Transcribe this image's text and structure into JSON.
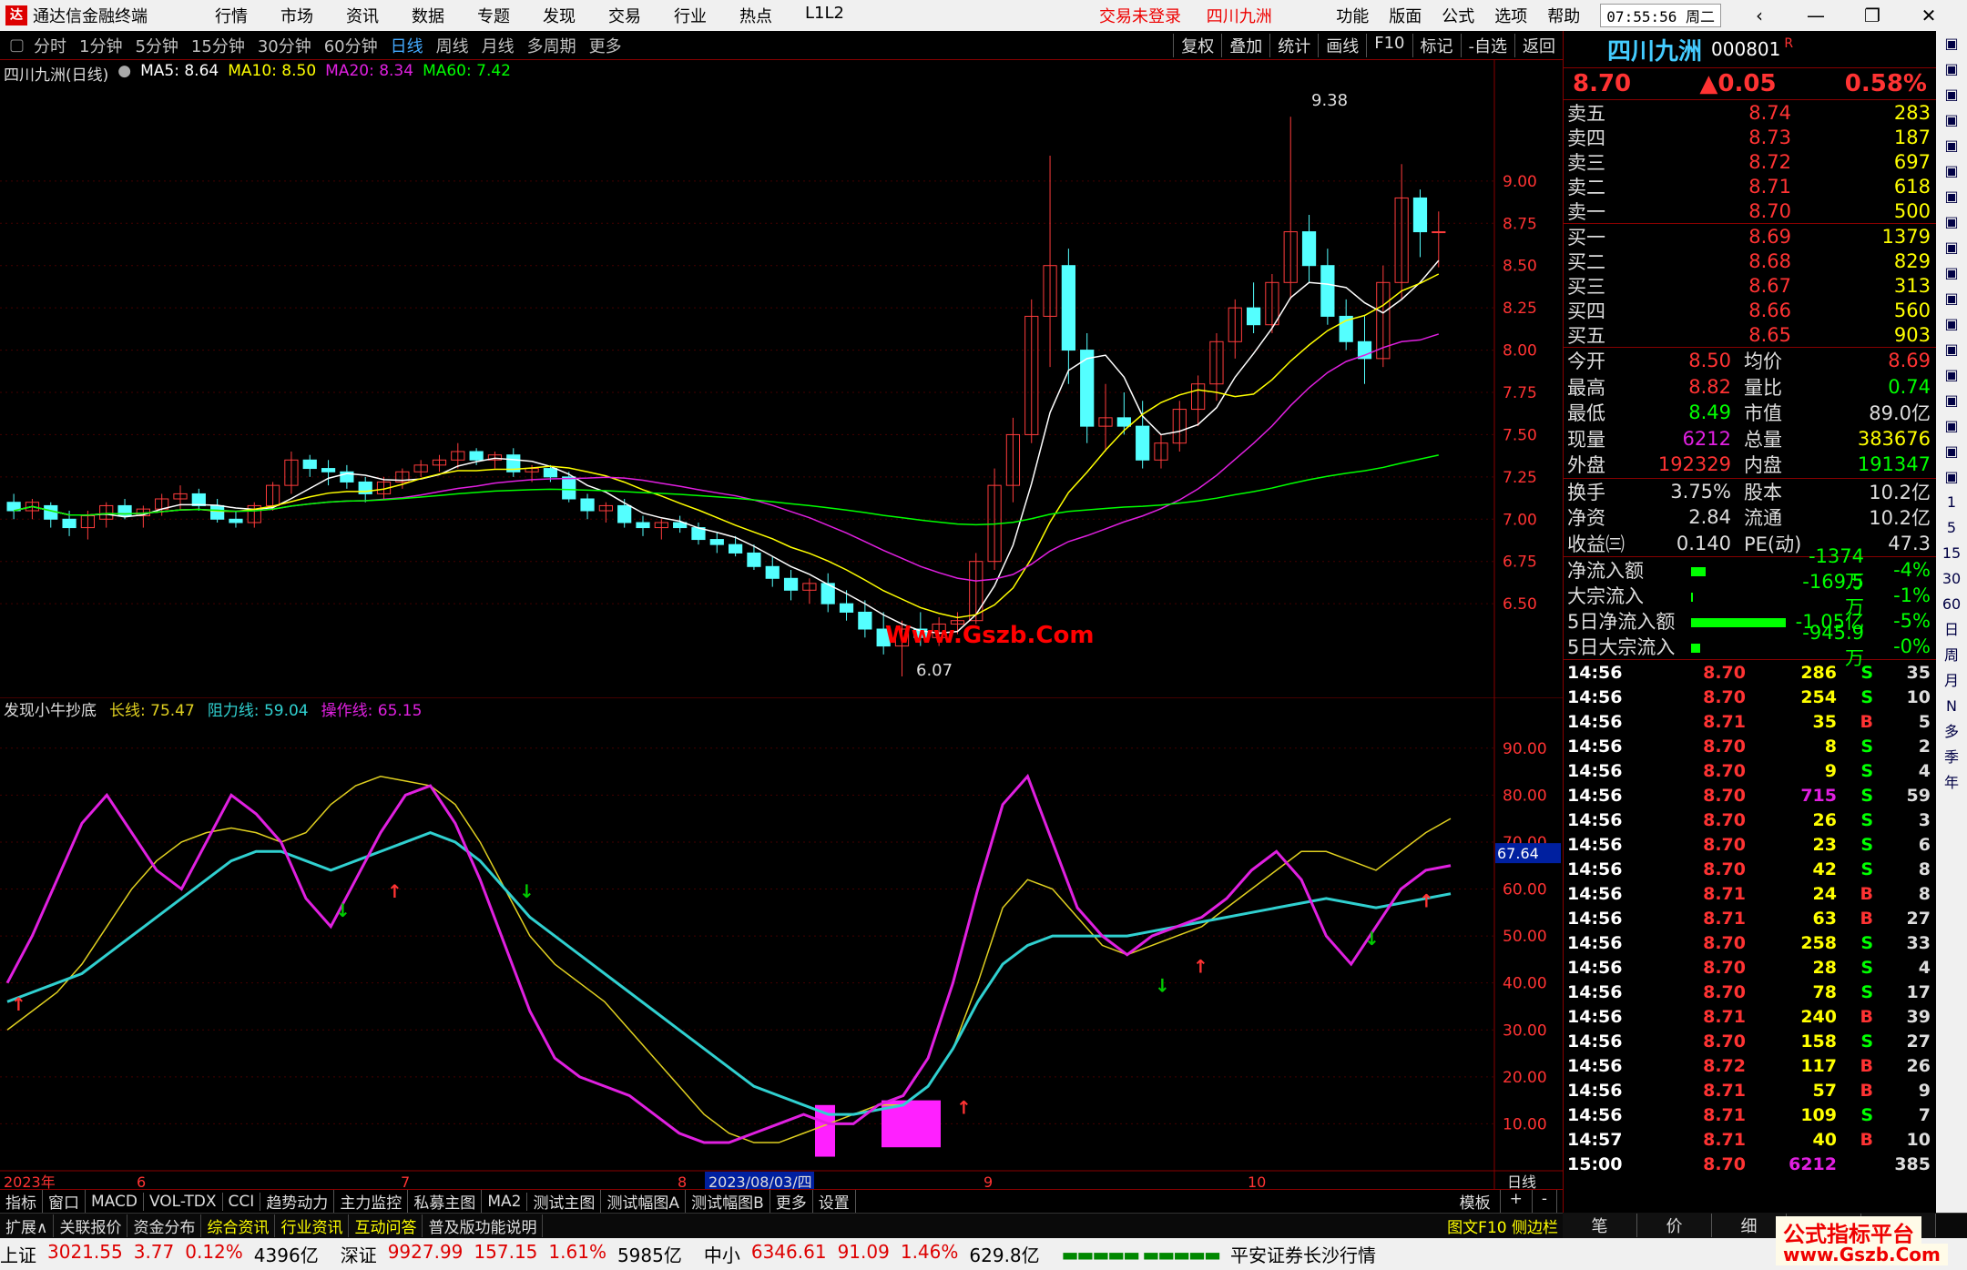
{
  "titlebar": {
    "app_title": "通达信金融终端",
    "menu": [
      "行情",
      "市场",
      "资讯",
      "数据",
      "专题",
      "发现",
      "交易",
      "行业",
      "热点",
      "L1L2"
    ],
    "login_status": "交易未登录",
    "stock_name": "四川九洲",
    "right_menu": [
      "功能",
      "版面",
      "公式",
      "选项",
      "帮助"
    ],
    "clock": "07:55:56 周二"
  },
  "periodbar": {
    "periods": [
      "分时",
      "1分钟",
      "5分钟",
      "15分钟",
      "30分钟",
      "60分钟",
      "日线",
      "周线",
      "月线",
      "多周期",
      "更多"
    ],
    "active": "日线",
    "tools": [
      "复权",
      "叠加",
      "统计",
      "画线",
      "F10",
      "标记",
      "-自选",
      "返回"
    ]
  },
  "main_legend": {
    "name": "四川九洲(日线)",
    "ma5": "MA5: 8.64",
    "ma10": "MA10: 8.50",
    "ma20": "MA20: 8.34",
    "ma60": "MA60: 7.42"
  },
  "ind_legend": {
    "name": "发现小牛抄底",
    "l1": "长线: 75.47",
    "l2": "阻力线: 59.04",
    "l3": "操作线: 65.15"
  },
  "chart_data": [
    {
      "type": "candlestick",
      "title": "四川九洲(日线)",
      "ylim": [
        6.0,
        9.5
      ],
      "yticks": [
        "9.00",
        "8.75",
        "8.50",
        "8.25",
        "8.00",
        "7.75",
        "7.50",
        "7.25",
        "7.00",
        "6.75",
        "6.50"
      ],
      "annotations": [
        "9.38",
        "6.07",
        "Www.Gszb.Com"
      ],
      "ohlc": [
        [
          7.1,
          7.15,
          7.0,
          7.05
        ],
        [
          7.05,
          7.12,
          7.0,
          7.1
        ],
        [
          7.08,
          7.1,
          6.95,
          7.0
        ],
        [
          7.0,
          7.05,
          6.9,
          6.95
        ],
        [
          6.95,
          7.05,
          6.88,
          7.02
        ],
        [
          7.0,
          7.1,
          6.95,
          7.08
        ],
        [
          7.08,
          7.12,
          7.0,
          7.02
        ],
        [
          7.02,
          7.08,
          6.95,
          7.06
        ],
        [
          7.06,
          7.15,
          7.02,
          7.12
        ],
        [
          7.12,
          7.2,
          7.05,
          7.15
        ],
        [
          7.15,
          7.18,
          7.05,
          7.08
        ],
        [
          7.08,
          7.12,
          6.98,
          7.0
        ],
        [
          7.0,
          7.05,
          6.95,
          6.98
        ],
        [
          6.98,
          7.1,
          6.95,
          7.08
        ],
        [
          7.08,
          7.22,
          7.05,
          7.2
        ],
        [
          7.2,
          7.4,
          7.15,
          7.35
        ],
        [
          7.35,
          7.38,
          7.25,
          7.3
        ],
        [
          7.3,
          7.35,
          7.2,
          7.28
        ],
        [
          7.28,
          7.32,
          7.18,
          7.22
        ],
        [
          7.22,
          7.25,
          7.1,
          7.15
        ],
        [
          7.15,
          7.25,
          7.12,
          7.22
        ],
        [
          7.22,
          7.3,
          7.18,
          7.28
        ],
        [
          7.28,
          7.35,
          7.25,
          7.32
        ],
        [
          7.32,
          7.38,
          7.28,
          7.35
        ],
        [
          7.35,
          7.45,
          7.3,
          7.4
        ],
        [
          7.4,
          7.42,
          7.32,
          7.35
        ],
        [
          7.35,
          7.4,
          7.3,
          7.38
        ],
        [
          7.38,
          7.42,
          7.25,
          7.28
        ],
        [
          7.28,
          7.32,
          7.22,
          7.3
        ],
        [
          7.3,
          7.32,
          7.22,
          7.25
        ],
        [
          7.25,
          7.28,
          7.1,
          7.12
        ],
        [
          7.12,
          7.15,
          7.0,
          7.05
        ],
        [
          7.05,
          7.1,
          6.98,
          7.08
        ],
        [
          7.08,
          7.12,
          6.95,
          6.98
        ],
        [
          6.98,
          7.02,
          6.9,
          6.95
        ],
        [
          6.95,
          7.0,
          6.88,
          6.98
        ],
        [
          6.98,
          7.02,
          6.92,
          6.95
        ],
        [
          6.95,
          6.98,
          6.85,
          6.88
        ],
        [
          6.88,
          6.92,
          6.8,
          6.85
        ],
        [
          6.85,
          6.9,
          6.78,
          6.8
        ],
        [
          6.8,
          6.85,
          6.7,
          6.72
        ],
        [
          6.72,
          6.78,
          6.6,
          6.65
        ],
        [
          6.65,
          6.7,
          6.52,
          6.58
        ],
        [
          6.58,
          6.65,
          6.5,
          6.62
        ],
        [
          6.62,
          6.68,
          6.45,
          6.5
        ],
        [
          6.5,
          6.58,
          6.4,
          6.45
        ],
        [
          6.45,
          6.52,
          6.3,
          6.35
        ],
        [
          6.35,
          6.45,
          6.2,
          6.25
        ],
        [
          6.25,
          6.4,
          6.07,
          6.35
        ],
        [
          6.35,
          6.45,
          6.25,
          6.3
        ],
        [
          6.3,
          6.42,
          6.25,
          6.38
        ],
        [
          6.38,
          6.45,
          6.32,
          6.4
        ],
        [
          6.4,
          6.8,
          6.38,
          6.75
        ],
        [
          6.75,
          7.3,
          6.7,
          7.2
        ],
        [
          7.2,
          7.6,
          7.1,
          7.5
        ],
        [
          7.5,
          8.3,
          7.45,
          8.2
        ],
        [
          8.2,
          9.15,
          7.9,
          8.5
        ],
        [
          8.5,
          8.6,
          7.8,
          8.0
        ],
        [
          8.0,
          8.1,
          7.45,
          7.55
        ],
        [
          7.55,
          7.8,
          7.4,
          7.6
        ],
        [
          7.6,
          7.75,
          7.5,
          7.55
        ],
        [
          7.55,
          7.7,
          7.3,
          7.35
        ],
        [
          7.35,
          7.5,
          7.3,
          7.45
        ],
        [
          7.45,
          7.7,
          7.4,
          7.65
        ],
        [
          7.65,
          7.85,
          7.55,
          7.8
        ],
        [
          7.8,
          8.1,
          7.7,
          8.05
        ],
        [
          8.05,
          8.3,
          7.95,
          8.25
        ],
        [
          8.25,
          8.4,
          8.1,
          8.15
        ],
        [
          8.15,
          8.45,
          8.1,
          8.4
        ],
        [
          8.4,
          9.38,
          8.3,
          8.7
        ],
        [
          8.7,
          8.8,
          8.4,
          8.5
        ],
        [
          8.5,
          8.6,
          8.15,
          8.2
        ],
        [
          8.2,
          8.3,
          8.0,
          8.05
        ],
        [
          8.05,
          8.2,
          7.8,
          7.95
        ],
        [
          7.95,
          8.5,
          7.9,
          8.4
        ],
        [
          8.4,
          9.1,
          8.3,
          8.9
        ],
        [
          8.9,
          8.95,
          8.55,
          8.7
        ],
        [
          8.7,
          8.82,
          8.49,
          8.7
        ]
      ]
    },
    {
      "type": "line",
      "title": "发现小牛抄底",
      "ylim": [
        0,
        95
      ],
      "yticks": [
        "90.00",
        "80.00",
        "70.00",
        "60.00",
        "50.00",
        "40.00",
        "30.00",
        "20.00",
        "10.00"
      ],
      "current_label": "67.64",
      "xlabels": [
        "2023年",
        "6",
        "7",
        "8",
        "2023/08/03/四",
        "9",
        "10",
        "日线"
      ],
      "series": [
        {
          "name": "长线",
          "color": "#e0d020",
          "values": [
            30,
            34,
            38,
            44,
            52,
            60,
            66,
            70,
            72,
            73,
            72,
            70,
            72,
            78,
            82,
            84,
            83,
            82,
            78,
            70,
            60,
            50,
            44,
            40,
            36,
            30,
            24,
            18,
            12,
            8,
            6,
            6,
            8,
            10,
            12,
            14,
            14,
            18,
            26,
            40,
            56,
            62,
            60,
            54,
            48,
            46,
            48,
            50,
            52,
            56,
            60,
            64,
            68,
            68,
            66,
            64,
            68,
            72,
            75
          ]
        },
        {
          "name": "阻力线",
          "color": "#30d0d0",
          "values": [
            36,
            38,
            40,
            42,
            46,
            50,
            54,
            58,
            62,
            66,
            68,
            68,
            66,
            64,
            66,
            68,
            70,
            72,
            70,
            66,
            60,
            54,
            50,
            46,
            42,
            38,
            34,
            30,
            26,
            22,
            18,
            16,
            14,
            12,
            12,
            13,
            14,
            18,
            26,
            36,
            44,
            48,
            50,
            50,
            50,
            50,
            51,
            52,
            53,
            54,
            55,
            56,
            57,
            58,
            57,
            56,
            57,
            58,
            59
          ]
        },
        {
          "name": "操作线",
          "color": "#e020e0",
          "values": [
            40,
            50,
            62,
            74,
            80,
            72,
            64,
            60,
            70,
            80,
            76,
            70,
            58,
            52,
            62,
            72,
            80,
            82,
            74,
            62,
            48,
            34,
            24,
            20,
            18,
            16,
            12,
            8,
            6,
            6,
            8,
            10,
            12,
            10,
            10,
            14,
            16,
            24,
            40,
            60,
            78,
            84,
            70,
            56,
            50,
            46,
            50,
            52,
            54,
            58,
            64,
            68,
            62,
            50,
            44,
            52,
            60,
            64,
            65
          ]
        }
      ]
    }
  ],
  "ind_tabs": [
    "指标",
    "窗口",
    "MACD",
    "VOL-TDX",
    "CCI",
    "趋势动力",
    "主力监控",
    "私募主图",
    "MA2",
    "测试主图",
    "测试幅图A",
    "测试幅图B",
    "更多",
    "设置"
  ],
  "ind_tabs_right": [
    "模板",
    "+",
    "-"
  ],
  "bottom_tabs": [
    "扩展∧",
    "关联报价",
    "资金分布",
    "综合资讯",
    "行业资讯",
    "互动问答",
    "普及版功能说明"
  ],
  "bottom_tabs_sel": [
    "综合资讯",
    "行业资讯",
    "互动问答"
  ],
  "bottom_right": "图文F10 侧边栏《",
  "right_bottom_tabs": [
    "笔",
    "价",
    "细",
    "势",
    "联"
  ],
  "statusbar": {
    "items": [
      {
        "name": "上证",
        "val": "3021.55",
        "chg": "3.77",
        "pct": "0.12%",
        "amt": "4396亿"
      },
      {
        "name": "深证",
        "val": "9927.99",
        "chg": "157.15",
        "pct": "1.61%",
        "amt": "5985亿"
      },
      {
        "name": "中小",
        "val": "6346.61",
        "chg": "91.09",
        "pct": "1.46%",
        "amt": "629.8亿"
      }
    ],
    "broker": "平安证券长沙行情"
  },
  "brand": {
    "top": "公式指标平台",
    "bottom": "www.Gszb.Com"
  },
  "rpanel": {
    "name": "四川九洲",
    "code": "000801",
    "r_mark": "R",
    "price": "8.70",
    "change": "▲0.05",
    "pct": "0.58%",
    "asks": [
      {
        "label": "卖五",
        "price": "8.74",
        "vol": "283"
      },
      {
        "label": "卖四",
        "price": "8.73",
        "vol": "187"
      },
      {
        "label": "卖三",
        "price": "8.72",
        "vol": "697"
      },
      {
        "label": "卖二",
        "price": "8.71",
        "vol": "618"
      },
      {
        "label": "卖一",
        "price": "8.70",
        "vol": "500"
      }
    ],
    "bids": [
      {
        "label": "买一",
        "price": "8.69",
        "vol": "1379"
      },
      {
        "label": "买二",
        "price": "8.68",
        "vol": "829"
      },
      {
        "label": "买三",
        "price": "8.67",
        "vol": "313"
      },
      {
        "label": "买四",
        "price": "8.66",
        "vol": "560"
      },
      {
        "label": "买五",
        "price": "8.65",
        "vol": "903"
      }
    ],
    "stats": [
      {
        "k1": "今开",
        "v1": "8.50",
        "k2": "均价",
        "v2": "8.69",
        "c1": "#f33",
        "c2": "#f33"
      },
      {
        "k1": "最高",
        "v1": "8.82",
        "k2": "量比",
        "v2": "0.74",
        "c1": "#f33",
        "c2": "#0f0"
      },
      {
        "k1": "最低",
        "v1": "8.49",
        "k2": "市值",
        "v2": "89.0亿",
        "c1": "#0f0",
        "c2": "#ddd"
      },
      {
        "k1": "现量",
        "v1": "6212",
        "k2": "总量",
        "v2": "383676",
        "c1": "#e020e0",
        "c2": "#ff0"
      },
      {
        "k1": "外盘",
        "v1": "192329",
        "k2": "内盘",
        "v2": "191347",
        "c1": "#f33",
        "c2": "#0f0"
      }
    ],
    "stats2": [
      {
        "k1": "换手",
        "v1": "3.75%",
        "k2": "股本",
        "v2": "10.2亿"
      },
      {
        "k1": "净资",
        "v1": "2.84",
        "k2": "流通",
        "v2": "10.2亿"
      },
      {
        "k1": "收益㈢",
        "v1": "0.140",
        "k2": "PE(动)",
        "v2": "47.3"
      }
    ],
    "flows": [
      {
        "label": "净流入额",
        "fill": 0.15,
        "val": "-1374万",
        "pct": "-4%"
      },
      {
        "label": "大宗流入",
        "fill": 0.02,
        "val": "-169.5万",
        "pct": "-1%"
      },
      {
        "label": "5日净流入额",
        "fill": 1.0,
        "val": "-1.05亿",
        "pct": "-5%"
      },
      {
        "label": "5日大宗流入",
        "fill": 0.1,
        "val": "-945.9万",
        "pct": "-0%"
      }
    ],
    "ticks": [
      {
        "t": "14:56",
        "p": "8.70",
        "v": "286",
        "s": "S",
        "n": "35"
      },
      {
        "t": "14:56",
        "p": "8.70",
        "v": "254",
        "s": "S",
        "n": "10"
      },
      {
        "t": "14:56",
        "p": "8.71",
        "v": "35",
        "s": "B",
        "n": "5"
      },
      {
        "t": "14:56",
        "p": "8.70",
        "v": "8",
        "s": "S",
        "n": "2"
      },
      {
        "t": "14:56",
        "p": "8.70",
        "v": "9",
        "s": "S",
        "n": "4"
      },
      {
        "t": "14:56",
        "p": "8.70",
        "v": "715",
        "s": "S",
        "n": "59"
      },
      {
        "t": "14:56",
        "p": "8.70",
        "v": "26",
        "s": "S",
        "n": "3"
      },
      {
        "t": "14:56",
        "p": "8.70",
        "v": "23",
        "s": "S",
        "n": "6"
      },
      {
        "t": "14:56",
        "p": "8.70",
        "v": "42",
        "s": "S",
        "n": "8"
      },
      {
        "t": "14:56",
        "p": "8.71",
        "v": "24",
        "s": "B",
        "n": "8"
      },
      {
        "t": "14:56",
        "p": "8.71",
        "v": "63",
        "s": "B",
        "n": "27"
      },
      {
        "t": "14:56",
        "p": "8.70",
        "v": "258",
        "s": "S",
        "n": "33"
      },
      {
        "t": "14:56",
        "p": "8.70",
        "v": "28",
        "s": "S",
        "n": "4"
      },
      {
        "t": "14:56",
        "p": "8.70",
        "v": "78",
        "s": "S",
        "n": "17"
      },
      {
        "t": "14:56",
        "p": "8.71",
        "v": "240",
        "s": "B",
        "n": "39"
      },
      {
        "t": "14:56",
        "p": "8.70",
        "v": "158",
        "s": "S",
        "n": "27"
      },
      {
        "t": "14:56",
        "p": "8.72",
        "v": "117",
        "s": "B",
        "n": "26"
      },
      {
        "t": "14:56",
        "p": "8.71",
        "v": "57",
        "s": "B",
        "n": "9"
      },
      {
        "t": "14:56",
        "p": "8.71",
        "v": "109",
        "s": "S",
        "n": "7"
      },
      {
        "t": "14:57",
        "p": "8.71",
        "v": "40",
        "s": "B",
        "n": "10"
      },
      {
        "t": "15:00",
        "p": "8.70",
        "v": "6212",
        "s": "",
        "n": "385"
      }
    ]
  },
  "farright": [
    "日",
    "周",
    "月",
    "N",
    "多",
    "季",
    "年"
  ],
  "farright_nums": [
    "1",
    "5",
    "15",
    "30",
    "60"
  ]
}
